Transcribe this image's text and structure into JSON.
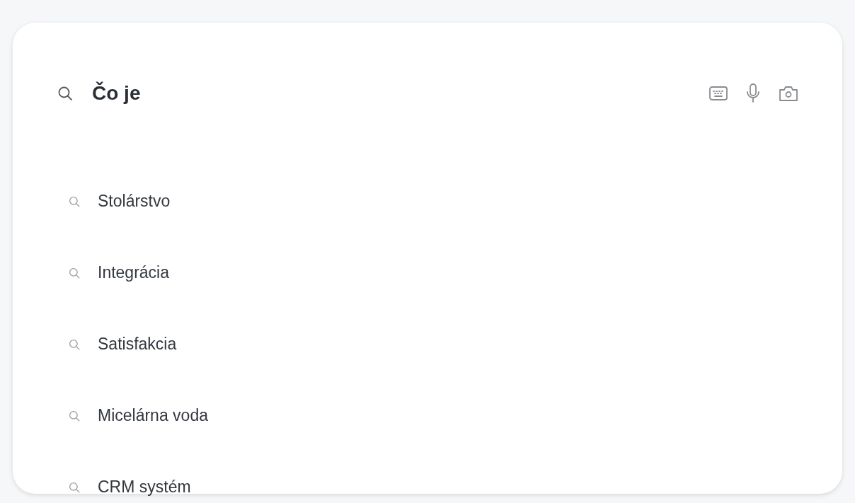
{
  "search": {
    "value": "Čo je"
  },
  "suggestions": [
    {
      "text": "Stolárstvo"
    },
    {
      "text": "Integrácia"
    },
    {
      "text": "Satisfakcia"
    },
    {
      "text": "Micelárna voda"
    },
    {
      "text": "CRM systém"
    }
  ]
}
